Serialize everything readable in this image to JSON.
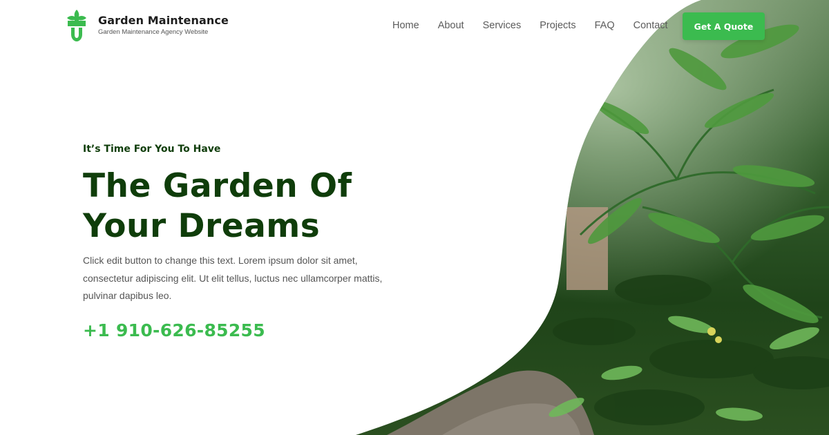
{
  "brand": {
    "title": "Garden Maintenance",
    "tagline": "Garden Maintenance Agency Website",
    "logo_icon": "leaf-spade-icon",
    "accent_color": "#3bbb4f",
    "heading_color": "#0f3d0a"
  },
  "nav": {
    "items": [
      {
        "label": "Home"
      },
      {
        "label": "About"
      },
      {
        "label": "Services"
      },
      {
        "label": "Projects"
      },
      {
        "label": "FAQ"
      },
      {
        "label": "Contact"
      }
    ],
    "cta_label": "Get A Quote"
  },
  "hero": {
    "kicker": "It’s Time For You To Have",
    "headline_line1": "The Garden Of",
    "headline_line2": "Your Dreams",
    "body": "Click edit button to change this text. Lorem ipsum dolor sit amet, consectetur adipiscing elit. Ut elit tellus, luctus nec ullamcorper mattis, pulvinar dapibus leo.",
    "phone": "+1 910-626-85255",
    "image_subject": "tropical garden plants"
  }
}
